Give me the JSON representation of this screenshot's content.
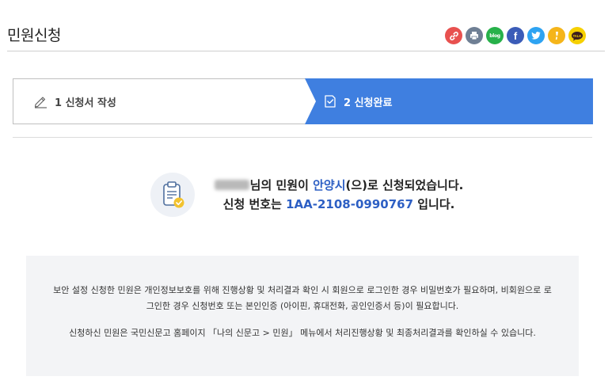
{
  "page": {
    "title": "민원신청"
  },
  "share": {
    "buttons": [
      {
        "name": "link-icon",
        "color": "#e8514f"
      },
      {
        "name": "print-icon",
        "color": "#6f7f94"
      },
      {
        "name": "blog-icon",
        "color": "#27b14a",
        "label": "blog"
      },
      {
        "name": "facebook-icon",
        "color": "#3b5cb8",
        "label": "f"
      },
      {
        "name": "twitter-icon",
        "color": "#2ea3f2"
      },
      {
        "name": "kakaostory-icon",
        "color": "#f5b51a"
      },
      {
        "name": "kakaotalk-icon",
        "color": "#f6d000",
        "label": "TALK"
      }
    ]
  },
  "steps": [
    {
      "label": "1 신청서 작성",
      "icon": "pencil-icon",
      "active": false
    },
    {
      "label": "2 신청완료",
      "icon": "check-document-icon",
      "active": true
    }
  ],
  "result": {
    "line1_suffix_a": "님의 민원이 ",
    "agency": "안양시",
    "line1_suffix_b": "(으)로 신청되었습니다.",
    "line2_prefix": "신청 번호는 ",
    "application_number": "1AA-2108-0990767",
    "line2_suffix": " 입니다."
  },
  "info": {
    "paragraph1": "보안 설정 신청한 민원은 개인정보보호를 위해 진행상황 및 처리결과 확인 시 회원으로 로그인한 경우 비밀번호가 필요하며, 비회원으로 로그인한 경우 신청번호 또는 본인인증 (아이핀, 휴대전화, 공인인증서 등)이 필요합니다.",
    "paragraph2": "신청하신 민원은 국민신문고 홈페이지 「나의 신문고 > 민원」 메뉴에서 처리진행상황 및 최종처리결과를 확인하실 수 있습니다."
  },
  "colors": {
    "active_step": "#3f7fe0",
    "highlight": "#2d5fc4",
    "info_bg": "#f3f4f6"
  }
}
